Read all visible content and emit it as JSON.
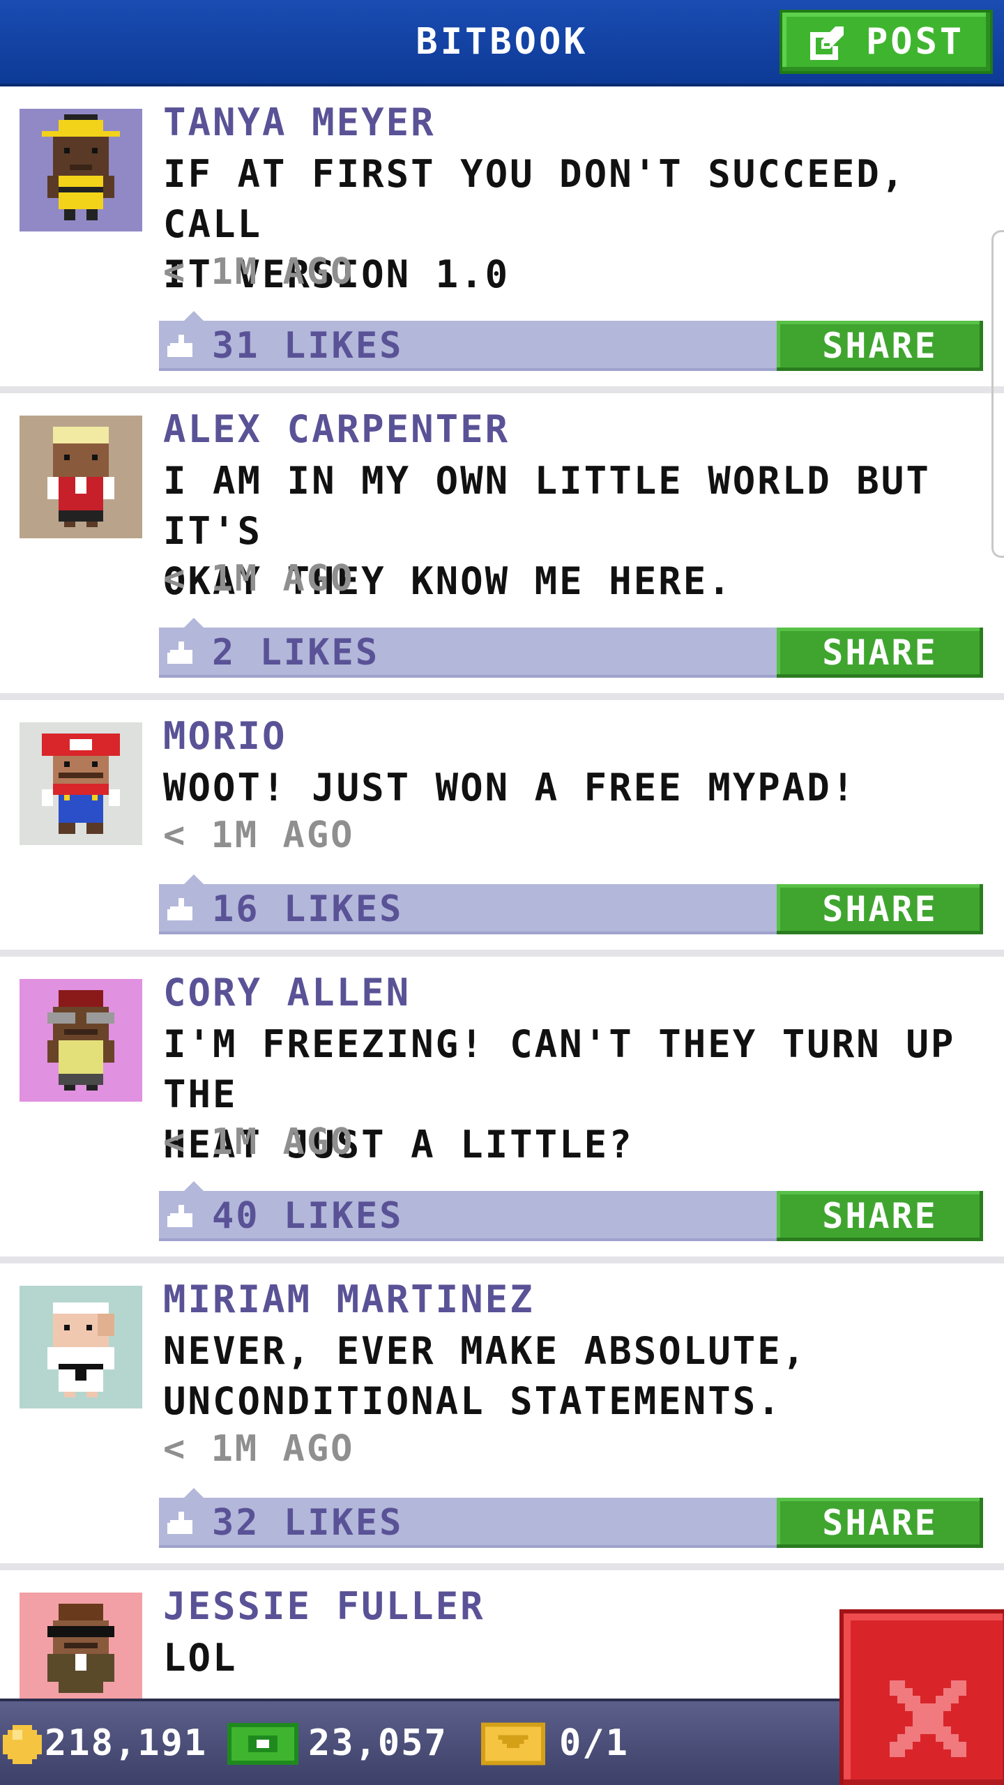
{
  "header": {
    "title": "BITBOOK",
    "post_label": "POST",
    "post_icon": "edit-icon"
  },
  "posts": [
    {
      "author": "TANYA MEYER",
      "message": "IF AT FIRST YOU DON'T SUCCEED, CALL\nIT VERSION 1.0",
      "time": "< 1M AGO",
      "likes": "31 LIKES",
      "share_label": "SHARE",
      "avatar_bg": "#9189c5"
    },
    {
      "author": "ALEX CARPENTER",
      "message": "I AM IN MY OWN LITTLE WORLD BUT IT'S\nOKAY THEY KNOW ME HERE.",
      "time": "< 1M AGO",
      "likes": "2 LIKES",
      "share_label": "SHARE",
      "avatar_bg": "#b9a48b"
    },
    {
      "author": "MORIO",
      "message": "WOOT! JUST WON A FREE MYPAD!",
      "time": "< 1M AGO",
      "likes": "16 LIKES",
      "share_label": "SHARE",
      "avatar_bg": "#dde0dd"
    },
    {
      "author": "CORY ALLEN",
      "message": "I'M FREEZING! CAN'T THEY TURN UP THE\nHEAT JUST A LITTLE?",
      "time": "< 1M AGO",
      "likes": "40 LIKES",
      "share_label": "SHARE",
      "avatar_bg": "#e091e0"
    },
    {
      "author": "MIRIAM MARTINEZ",
      "message": "NEVER, EVER MAKE ABSOLUTE,\nUNCONDITIONAL STATEMENTS.",
      "time": "< 1M AGO",
      "likes": "32 LIKES",
      "share_label": "SHARE",
      "avatar_bg": "#b5d6cf"
    },
    {
      "author": "JESSIE FULLER",
      "message": "LOL",
      "avatar_bg": "#f2a0a6"
    }
  ],
  "bottom_bar": {
    "coins": "218,191",
    "bux": "23,057",
    "tickets": "0/1"
  },
  "colors": {
    "header_blue": "#1a4cb2",
    "share_green": "#3fa52f",
    "like_bar": "#b3b7da",
    "author_purple": "#5a5296",
    "close_red": "#d9252a"
  }
}
